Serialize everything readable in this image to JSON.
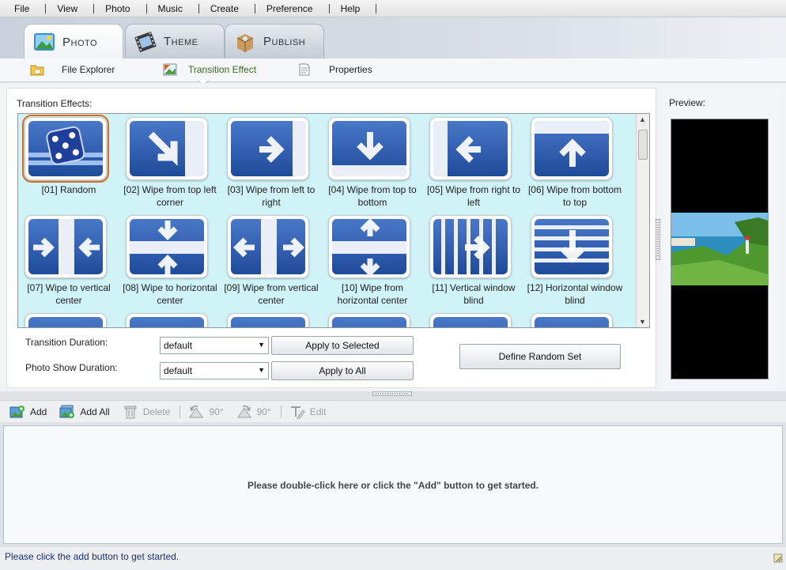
{
  "menu": [
    "File",
    "View",
    "Photo",
    "Music",
    "Create",
    "Preference",
    "Help"
  ],
  "tabs": [
    {
      "label": "Photo",
      "icon": "photo-icon",
      "active": true
    },
    {
      "label": "Theme",
      "icon": "film-icon",
      "active": false
    },
    {
      "label": "Publish",
      "icon": "package-icon",
      "active": false
    }
  ],
  "subnav": [
    {
      "label": "File Explorer",
      "icon": "folder-icon",
      "active": false
    },
    {
      "label": "Transition Effect",
      "icon": "picture-icon",
      "active": true
    },
    {
      "label": "Properties",
      "icon": "document-icon",
      "active": false
    }
  ],
  "effects": {
    "title": "Transition Effects:",
    "items": [
      {
        "label": "[01] Random",
        "glyph": "dice",
        "selected": true
      },
      {
        "label": "[02] Wipe from top left corner",
        "glyph": "diag"
      },
      {
        "label": "[03] Wipe from left to right",
        "glyph": "right"
      },
      {
        "label": "[04] Wipe from top to bottom",
        "glyph": "down"
      },
      {
        "label": "[05] Wipe from right to left",
        "glyph": "left"
      },
      {
        "label": "[06] Wipe from bottom to top",
        "glyph": "up"
      },
      {
        "label": "[07] Wipe to vertical center",
        "glyph": "vcenter"
      },
      {
        "label": "[08] Wipe to horizontal center",
        "glyph": "hcenter"
      },
      {
        "label": "[09] Wipe from vertical center",
        "glyph": "vout"
      },
      {
        "label": "[10] Wipe from horizontal center",
        "glyph": "hout"
      },
      {
        "label": "[11] Vertical window blind",
        "glyph": "vblind"
      },
      {
        "label": "[12] Horizontal window blind",
        "glyph": "hblind"
      }
    ]
  },
  "controls": {
    "transition_duration_label": "Transition Duration:",
    "photo_show_duration_label": "Photo Show Duration:",
    "transition_duration_value": "default",
    "photo_show_duration_value": "default",
    "apply_selected": "Apply to Selected",
    "apply_all": "Apply to All",
    "define_random": "Define Random Set"
  },
  "preview": {
    "title": "Preview:"
  },
  "toolbar": {
    "add": "Add",
    "add_all": "Add All",
    "delete": "Delete",
    "rotate_left": "90°",
    "rotate_right": "90°",
    "edit": "Edit"
  },
  "dropzone": {
    "message": "Please double-click here or click the \"Add\" button to get started."
  },
  "status": {
    "message": "Please click the add button to get started."
  },
  "colors": {
    "accent": "#3a6b1f",
    "tile_blue": "#2d5aa8",
    "grid_bg": "#cff3f7",
    "selection": "#d86b1e"
  }
}
